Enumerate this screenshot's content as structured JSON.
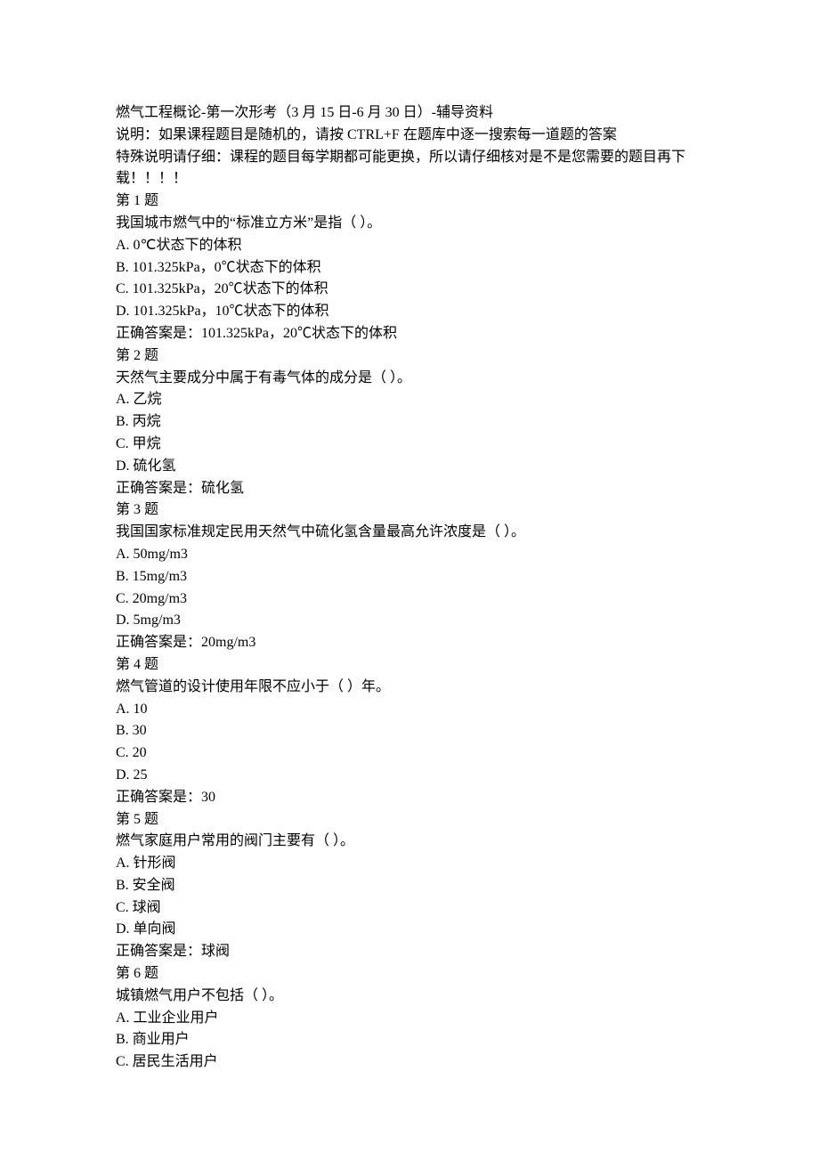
{
  "header": {
    "title": "燃气工程概论-第一次形考（3 月 15 日-6 月 30 日）-辅导资料",
    "note1": "说明：如果课程题目是随机的，请按 CTRL+F 在题库中逐一搜索每一道题的答案",
    "note2": "特殊说明请仔细：课程的题目每学期都可能更换，所以请仔细核对是不是您需要的题目再下载！！！！"
  },
  "questions": [
    {
      "heading": "第 1 题",
      "stem": "我国城市燃气中的“标准立方米”是指（ ）。",
      "options": [
        "A. 0℃状态下的体积",
        "B. 101.325kPa，0℃状态下的体积",
        "C. 101.325kPa，20℃状态下的体积",
        "D. 101.325kPa，10℃状态下的体积"
      ],
      "answer": "正确答案是：101.325kPa，20℃状态下的体积"
    },
    {
      "heading": "第 2 题",
      "stem": "天然气主要成分中属于有毒气体的成分是（ ）。",
      "options": [
        "A. 乙烷",
        "B. 丙烷",
        "C. 甲烷",
        "D. 硫化氢"
      ],
      "answer": "正确答案是：硫化氢"
    },
    {
      "heading": "第 3 题",
      "stem": "我国国家标准规定民用天然气中硫化氢含量最高允许浓度是（ ）。",
      "options": [
        "A. 50mg/m3",
        "B. 15mg/m3",
        "C. 20mg/m3",
        "D. 5mg/m3"
      ],
      "answer": "正确答案是：20mg/m3"
    },
    {
      "heading": "第 4 题",
      "stem": "燃气管道的设计使用年限不应小于（ ）年。",
      "options": [
        "A. 10",
        "B. 30",
        "C. 20",
        "D. 25"
      ],
      "answer": "正确答案是：30"
    },
    {
      "heading": "第 5 题",
      "stem": "燃气家庭用户常用的阀门主要有（ ）。",
      "options": [
        "A. 针形阀",
        "B. 安全阀",
        "C. 球阀",
        "D. 单向阀"
      ],
      "answer": "正确答案是：球阀"
    },
    {
      "heading": "第 6 题",
      "stem": "城镇燃气用户不包括（ ）。",
      "options": [
        "A. 工业企业用户",
        "B. 商业用户",
        "C. 居民生活用户"
      ],
      "answer": ""
    }
  ]
}
